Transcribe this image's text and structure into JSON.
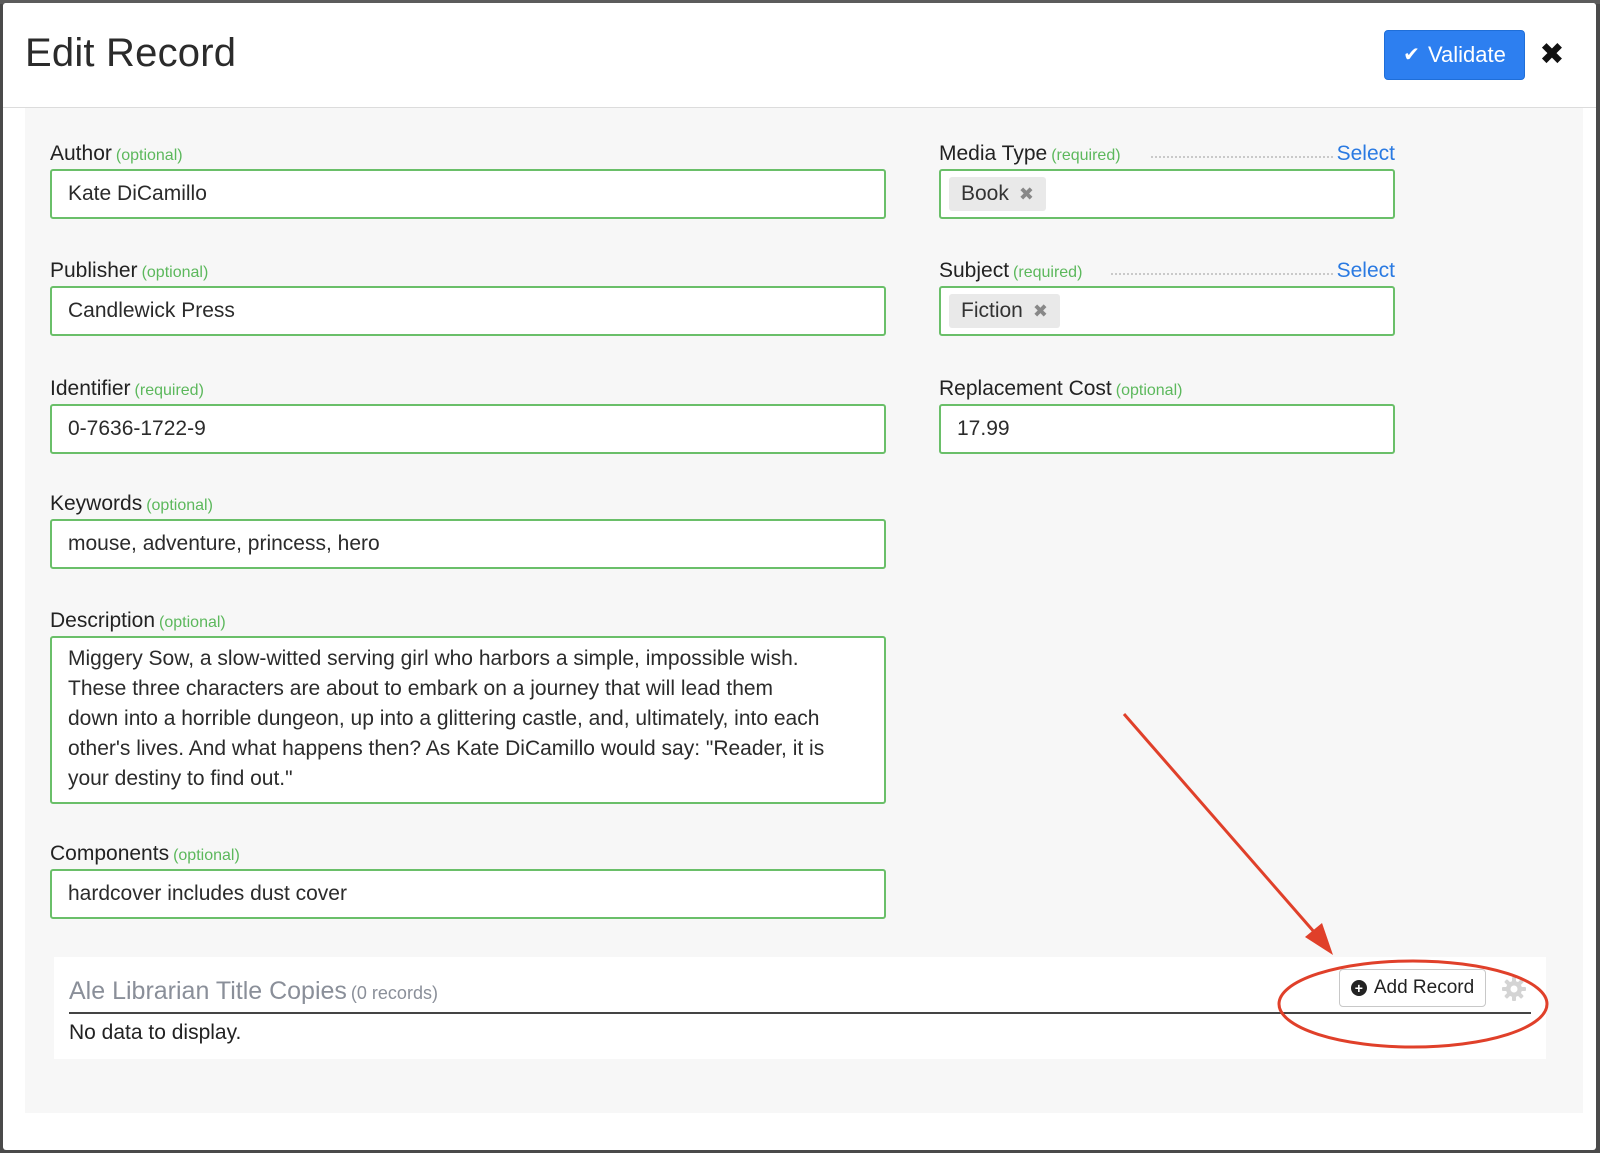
{
  "modal": {
    "title": "Edit Record",
    "validate_label": "Validate",
    "close_glyph": "✖"
  },
  "fields": {
    "author": {
      "label": "Author",
      "hint": "(optional)",
      "value": "Kate DiCamillo"
    },
    "publisher": {
      "label": "Publisher",
      "hint": "(optional)",
      "value": "Candlewick Press"
    },
    "identifier": {
      "label": "Identifier",
      "hint": "(required)",
      "value": "0-7636-1722-9"
    },
    "keywords": {
      "label": "Keywords",
      "hint": "(optional)",
      "value": "mouse, adventure, princess, hero"
    },
    "description": {
      "label": "Description",
      "hint": "(optional)",
      "lines": [
        "Miggery Sow, a slow-witted serving girl who harbors a simple, impossible wish.",
        "These three characters are about to embark on a journey that will lead them",
        "down into a horrible dungeon, up into a glittering castle, and, ultimately, into each",
        "other's lives. And what happens then? As Kate DiCamillo would say: \"Reader, it is",
        "your destiny to find out.\""
      ]
    },
    "components": {
      "label": "Components",
      "hint": "(optional)",
      "value": "hardcover includes dust cover"
    },
    "media_type": {
      "label": "Media Type",
      "hint": "(required)",
      "select_label": "Select",
      "tag": "Book"
    },
    "subject": {
      "label": "Subject",
      "hint": "(required)",
      "select_label": "Select",
      "tag": "Fiction"
    },
    "replacement_cost": {
      "label": "Replacement Cost",
      "hint": "(optional)",
      "value": "17.99"
    }
  },
  "copies": {
    "title": "Ale Librarian Title Copies",
    "count": "(0 records)",
    "empty_text": "No data to display.",
    "add_label": "Add Record"
  },
  "icons": {
    "validate": "check-icon",
    "close": "close-icon",
    "tag_remove": "remove-tag-icon",
    "add": "plus-circle-icon",
    "settings": "gear-icon"
  },
  "colors": {
    "primary": "#2d7ff0",
    "valid_border": "#6abf69",
    "hint_green": "#5cb85c",
    "link": "#2a7ae2",
    "annotation_red": "#e0402a"
  }
}
